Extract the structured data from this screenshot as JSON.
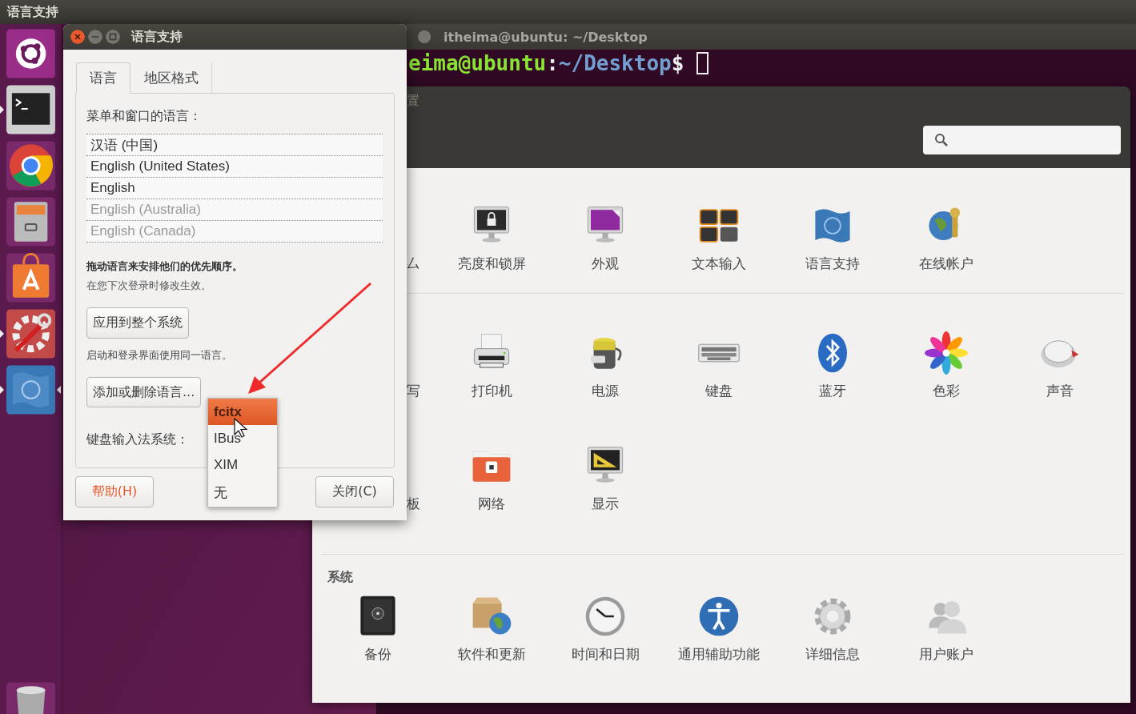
{
  "top_bar": {
    "title": "语言支持"
  },
  "launcher": {
    "items": [
      {
        "running": false,
        "focused": false
      },
      {
        "running": true,
        "focused": false
      },
      {
        "running": false,
        "focused": false
      },
      {
        "running": false,
        "focused": false
      },
      {
        "running": false,
        "focused": false
      },
      {
        "running": true,
        "focused": false
      },
      {
        "running": true,
        "focused": true
      },
      {
        "running": false,
        "focused": false
      }
    ]
  },
  "terminal": {
    "title": "itheima@ubuntu: ~/Desktop",
    "prompt_user": "eima@ubuntu",
    "prompt_separator": ":",
    "prompt_path": "~/Desktop",
    "prompt_symbol": "$"
  },
  "settings": {
    "title": "置",
    "sections": [
      {
        "items": [
          {
            "label": "厶",
            "kind": "partial"
          },
          {
            "label": "亮度和锁屏",
            "kind": "item"
          },
          {
            "label": "外观",
            "kind": "item"
          },
          {
            "label": "文本输入",
            "kind": "item"
          },
          {
            "label": "语言支持",
            "kind": "item"
          },
          {
            "label": "在线帐户",
            "kind": "item"
          }
        ]
      },
      {
        "items": [
          {
            "label": "写",
            "kind": "partial"
          },
          {
            "label": "打印机",
            "kind": "item"
          },
          {
            "label": "电源",
            "kind": "item"
          },
          {
            "label": "键盘",
            "kind": "item"
          },
          {
            "label": "蓝牙",
            "kind": "item"
          },
          {
            "label": "色彩",
            "kind": "item"
          },
          {
            "label": "声音",
            "kind": "item"
          },
          {
            "label": "板",
            "kind": "partial"
          },
          {
            "label": "网络",
            "kind": "item"
          },
          {
            "label": "显示",
            "kind": "item"
          }
        ]
      },
      {
        "title": "系统",
        "items": [
          {
            "label": "备份",
            "kind": "item"
          },
          {
            "label": "软件和更新",
            "kind": "item"
          },
          {
            "label": "时间和日期",
            "kind": "item"
          },
          {
            "label": "通用辅助功能",
            "kind": "item"
          },
          {
            "label": "详细信息",
            "kind": "item"
          },
          {
            "label": "用户账户",
            "kind": "item"
          }
        ]
      }
    ]
  },
  "dialog": {
    "title": "语言支持",
    "tabs": [
      {
        "label": "语言",
        "selected": true
      },
      {
        "label": "地区格式",
        "selected": false
      }
    ],
    "languages_label": "菜单和窗口的语言：",
    "languages": [
      {
        "name": "汉语 (中国)",
        "disabled": false
      },
      {
        "name": "English (United States)",
        "disabled": false
      },
      {
        "name": "English",
        "disabled": false
      },
      {
        "name": "English (Australia)",
        "disabled": true
      },
      {
        "name": "English (Canada)",
        "disabled": true
      }
    ],
    "order_hint": "拖动语言来安排他们的优先顺序。",
    "login_hint": "在您下次登录时修改生效。",
    "apply_button": "应用到整个系统",
    "login_note": "启动和登录界面使用同一语言。",
    "add_button": "添加或删除语言...",
    "input_label": "键盘输入法系统：",
    "input_menu": [
      {
        "label": "fcitx",
        "selected": true
      },
      {
        "label": "IBus",
        "selected": false
      },
      {
        "label": "XIM",
        "selected": false
      },
      {
        "label": "无",
        "selected": false
      }
    ],
    "help_button": "帮助(H)",
    "close_button": "关闭(C)"
  }
}
